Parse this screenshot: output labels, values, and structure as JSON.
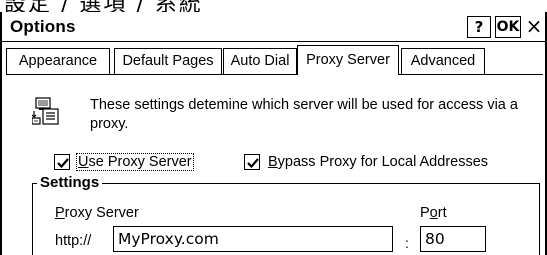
{
  "top_strip": {
    "text": "設定 / 選項 / 系統"
  },
  "window": {
    "title": "Options",
    "help_label": "?",
    "ok_label": "OK",
    "close_label": "×"
  },
  "tabs": [
    {
      "label": "Appearance",
      "active": false
    },
    {
      "label": "Default Pages",
      "active": false
    },
    {
      "label": "Auto Dial",
      "active": false
    },
    {
      "label": "Proxy Server",
      "active": true
    },
    {
      "label": "Advanced",
      "active": false
    }
  ],
  "proxy": {
    "info_text": "These settings detemine which server will be used for access via a proxy.",
    "use_proxy": {
      "accel": "U",
      "label_rest": "se Proxy Server",
      "checked": true
    },
    "bypass_proxy": {
      "accel": "B",
      "label_rest": "ypass Proxy for Local Addresses",
      "checked": true
    },
    "settings": {
      "group_title": "Settings",
      "server_label_accel": "P",
      "server_label_rest": "roxy Server",
      "port_label_pre": "P",
      "port_label_accel": "o",
      "port_label_rest": "rt",
      "prefix": "http://",
      "colon": ":",
      "server_value": "MyProxy.com",
      "port_value": "80"
    }
  }
}
